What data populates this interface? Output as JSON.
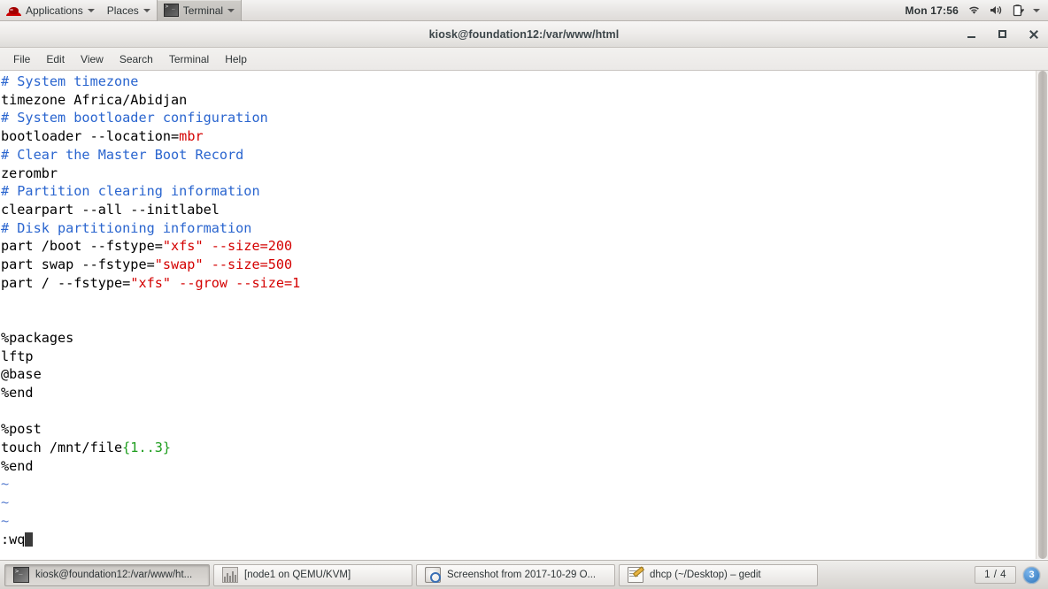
{
  "top_panel": {
    "applications_label": "Applications",
    "places_label": "Places",
    "active_window_label": "Terminal",
    "clock": "Mon 17:56",
    "icons": [
      "redhat-logo",
      "wifi-icon",
      "volume-icon",
      "battery-icon",
      "chevron-down-icon"
    ]
  },
  "window": {
    "title": "kiosk@foundation12:/var/www/html",
    "controls": {
      "minimize": "–",
      "maximize": "□",
      "close": "✕"
    },
    "menu": [
      "File",
      "Edit",
      "View",
      "Search",
      "Terminal",
      "Help"
    ]
  },
  "terminal": {
    "lines": [
      [
        {
          "t": "# System timezone",
          "c": "cmt"
        }
      ],
      [
        {
          "t": "timezone Africa/Abidjan",
          "c": ""
        }
      ],
      [
        {
          "t": "# System bootloader configuration",
          "c": "cmt"
        }
      ],
      [
        {
          "t": "bootloader --location=",
          "c": ""
        },
        {
          "t": "mbr",
          "c": "red"
        }
      ],
      [
        {
          "t": "# Clear the Master Boot Record",
          "c": "cmt"
        }
      ],
      [
        {
          "t": "zerombr",
          "c": ""
        }
      ],
      [
        {
          "t": "# Partition clearing information",
          "c": "cmt"
        }
      ],
      [
        {
          "t": "clearpart --all --initlabel",
          "c": ""
        }
      ],
      [
        {
          "t": "# Disk partitioning information",
          "c": "cmt"
        }
      ],
      [
        {
          "t": "part /boot --fstype=",
          "c": ""
        },
        {
          "t": "\"xfs\" --size=200",
          "c": "red"
        }
      ],
      [
        {
          "t": "part swap --fstype=",
          "c": ""
        },
        {
          "t": "\"swap\" --size=500",
          "c": "red"
        }
      ],
      [
        {
          "t": "part / --fstype=",
          "c": ""
        },
        {
          "t": "\"xfs\" --grow --size=1",
          "c": "red"
        }
      ],
      [],
      [],
      [
        {
          "t": "%packages",
          "c": ""
        }
      ],
      [
        {
          "t": "lftp",
          "c": ""
        }
      ],
      [
        {
          "t": "@base",
          "c": ""
        }
      ],
      [
        {
          "t": "%end",
          "c": ""
        }
      ],
      [],
      [
        {
          "t": "%post",
          "c": ""
        }
      ],
      [
        {
          "t": "touch /mnt/file",
          "c": ""
        },
        {
          "t": "{1..3}",
          "c": "grn"
        }
      ],
      [
        {
          "t": "%end",
          "c": ""
        }
      ],
      [
        {
          "t": "~",
          "c": "tilde"
        }
      ],
      [
        {
          "t": "~",
          "c": "tilde"
        }
      ],
      [
        {
          "t": "~",
          "c": "tilde"
        }
      ],
      [
        {
          "t": ":wq",
          "c": "",
          "cursor": true
        }
      ]
    ]
  },
  "taskbar": {
    "buttons": [
      {
        "label": "kiosk@foundation12:/var/www/ht...",
        "icon": "terminal-icon",
        "pressed": true
      },
      {
        "label": "[node1 on QEMU/KVM]",
        "icon": "virt-manager-icon",
        "pressed": false
      },
      {
        "label": "Screenshot from 2017-10-29 O...",
        "icon": "image-viewer-icon",
        "pressed": false
      },
      {
        "label": "dhcp (~/Desktop) – gedit",
        "icon": "gedit-icon",
        "pressed": false
      }
    ],
    "workspace": "1 / 4",
    "notification_count": "3"
  },
  "colors": {
    "comment_blue": "#2a65cf",
    "value_red": "#d40000",
    "brace_green": "#1f9e1f",
    "tilde_blue": "#5a7fd0",
    "terminal_bg": "#ffffff",
    "terminal_fg": "#000000",
    "panel_bg": "#e8e6e4",
    "badge_blue": "#2a6fb5"
  }
}
